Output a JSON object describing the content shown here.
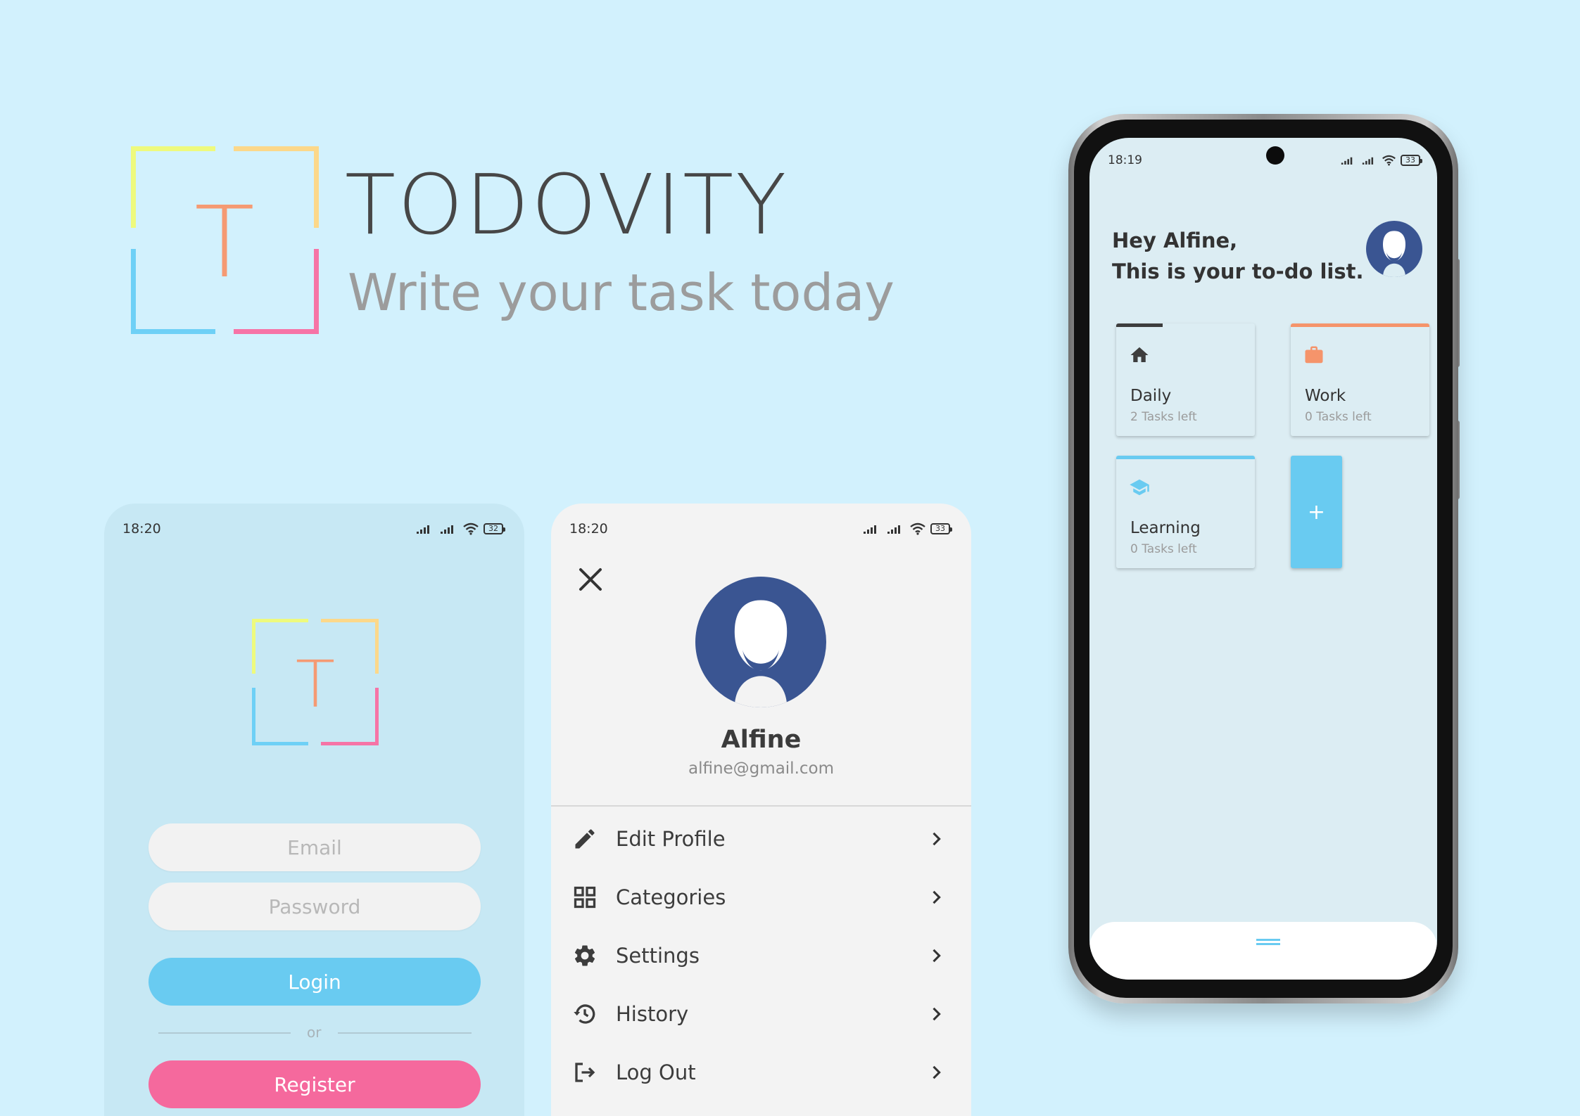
{
  "brand": {
    "logo_letter": "T",
    "title": "TODOVITY",
    "tagline": "Write your task today"
  },
  "colors": {
    "background": "#d2f1fd",
    "logo_yellow": "#eefa7d",
    "logo_orange": "#fcd88a",
    "logo_blue": "#6ed0f6",
    "logo_pink": "#f674a6",
    "logo_letter": "#f59a73",
    "primary": "#69cbf1",
    "accent_pink": "#f5699d",
    "work_orange": "#f5946b",
    "avatar_blue": "#3a5592"
  },
  "login_screen": {
    "status_time": "18:20",
    "battery": "32",
    "email_placeholder": "Email",
    "password_placeholder": "Password",
    "login_label": "Login",
    "or_label": "or",
    "register_label": "Register"
  },
  "profile_screen": {
    "status_time": "18:20",
    "battery": "33",
    "close_icon": "close-icon",
    "name": "Alfine",
    "email": "alfine@gmail.com",
    "items": [
      {
        "label": "Edit Profile",
        "icon": "pencil-icon"
      },
      {
        "label": "Categories",
        "icon": "grid-icon"
      },
      {
        "label": "Settings",
        "icon": "gear-icon"
      },
      {
        "label": "History",
        "icon": "history-icon"
      },
      {
        "label": "Log Out",
        "icon": "logout-icon"
      }
    ]
  },
  "home_screen": {
    "status_time": "18:19",
    "battery": "33",
    "greeting_line1": "Hey Alfine,",
    "greeting_line2": "This is your to-do list.",
    "categories": [
      {
        "name": "Daily",
        "subtitle": "2 Tasks left",
        "icon": "home-icon",
        "color": "#3d3d3d"
      },
      {
        "name": "Work",
        "subtitle": "0 Tasks left",
        "icon": "briefcase-icon",
        "color": "#f5946b"
      },
      {
        "name": "Learning",
        "subtitle": "0 Tasks left",
        "icon": "graduation-cap-icon",
        "color": "#69cbf1"
      }
    ],
    "add_label": "+"
  }
}
